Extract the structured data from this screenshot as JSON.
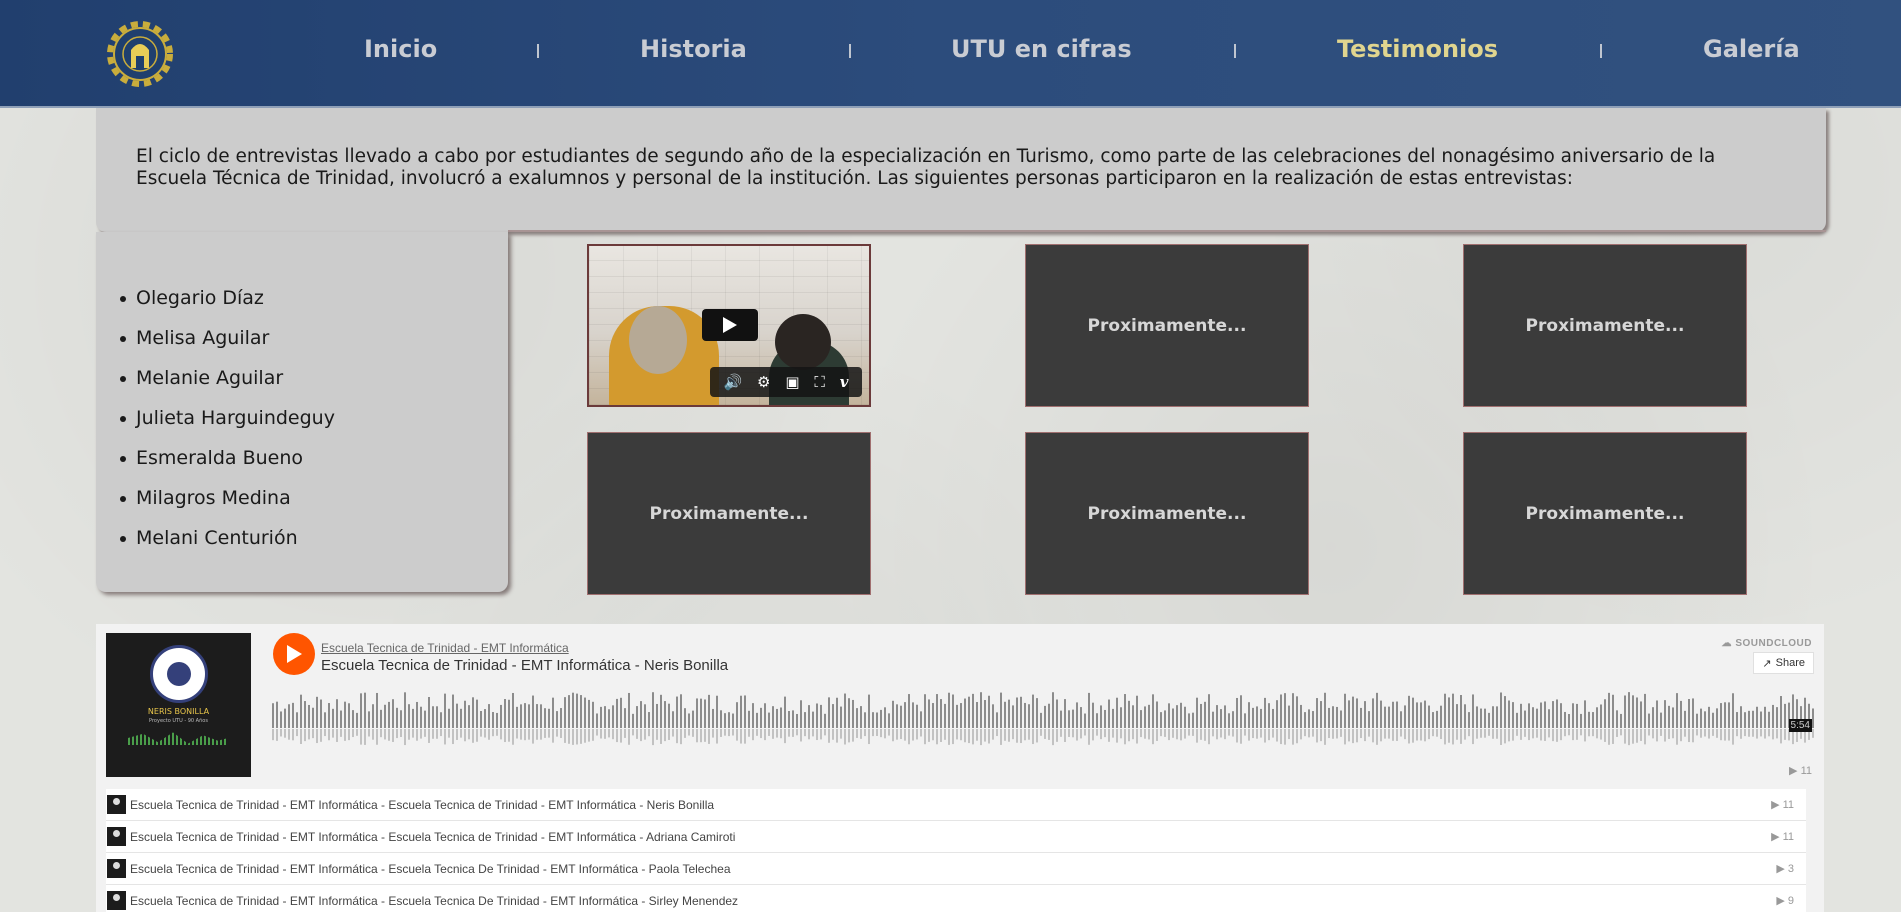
{
  "header": {
    "logo_text": "Escuela Tecnica Trinidad",
    "nav": [
      {
        "label": "Inicio",
        "active": false
      },
      {
        "label": "Historia",
        "active": false
      },
      {
        "label": "UTU en cifras",
        "active": false
      },
      {
        "label": "Testimonios",
        "active": true
      },
      {
        "label": "Galería",
        "active": false
      }
    ],
    "active_color": "#e0d58f"
  },
  "intro": {
    "text": "El ciclo de entrevistas llevado a cabo por estudiantes de segundo año de la especialización en Turismo, como parte de las celebraciones del nonagésimo aniversario de la Escuela Técnica de Trinidad, involucró a exalumnos y personal de la institución. Las siguientes personas participaron en la realización de estas entrevistas:"
  },
  "participants": [
    "Olegario Díaz",
    "Melisa Aguilar",
    "Melanie Aguilar",
    "Julieta Harguindeguy",
    "Esmeralda Bueno",
    "Milagros Medina",
    "Melani Centurión"
  ],
  "videos": {
    "placeholder_label": "Proximamente...",
    "player_controls": [
      "volume-icon",
      "settings-icon",
      "pip-icon",
      "fullscreen-icon",
      "vimeo-icon"
    ]
  },
  "soundcloud": {
    "brand": "SOUNDCLOUD",
    "share_label": "Share",
    "user": "Escuela Tecnica de Trinidad - EMT Informática",
    "title": "Escuela Tecnica de Trinidad - EMT Informática - Neris Bonilla",
    "artwork_name": "NERIS BONILLA",
    "artwork_sub": "Proyecto UTU - 90 Años",
    "duration": "5:54",
    "plays": "11",
    "accent": "#ff5500",
    "tracks": [
      {
        "title": "Escuela Tecnica de Trinidad - EMT Informática - Escuela Tecnica de Trinidad - EMT Informática - Neris Bonilla",
        "plays": "11"
      },
      {
        "title": "Escuela Tecnica de Trinidad - EMT Informática - Escuela Tecnica de Trinidad - EMT Informática - Adriana Camiroti",
        "plays": "11"
      },
      {
        "title": "Escuela Tecnica de Trinidad - EMT Informática - Escuela Tecnica De Trinidad - EMT Informática - Paola Telechea",
        "plays": "3"
      },
      {
        "title": "Escuela Tecnica de Trinidad - EMT Informática - Escuela Tecnica De Trinidad - EMT Informática - Sirley Menendez",
        "plays": "9"
      }
    ]
  }
}
